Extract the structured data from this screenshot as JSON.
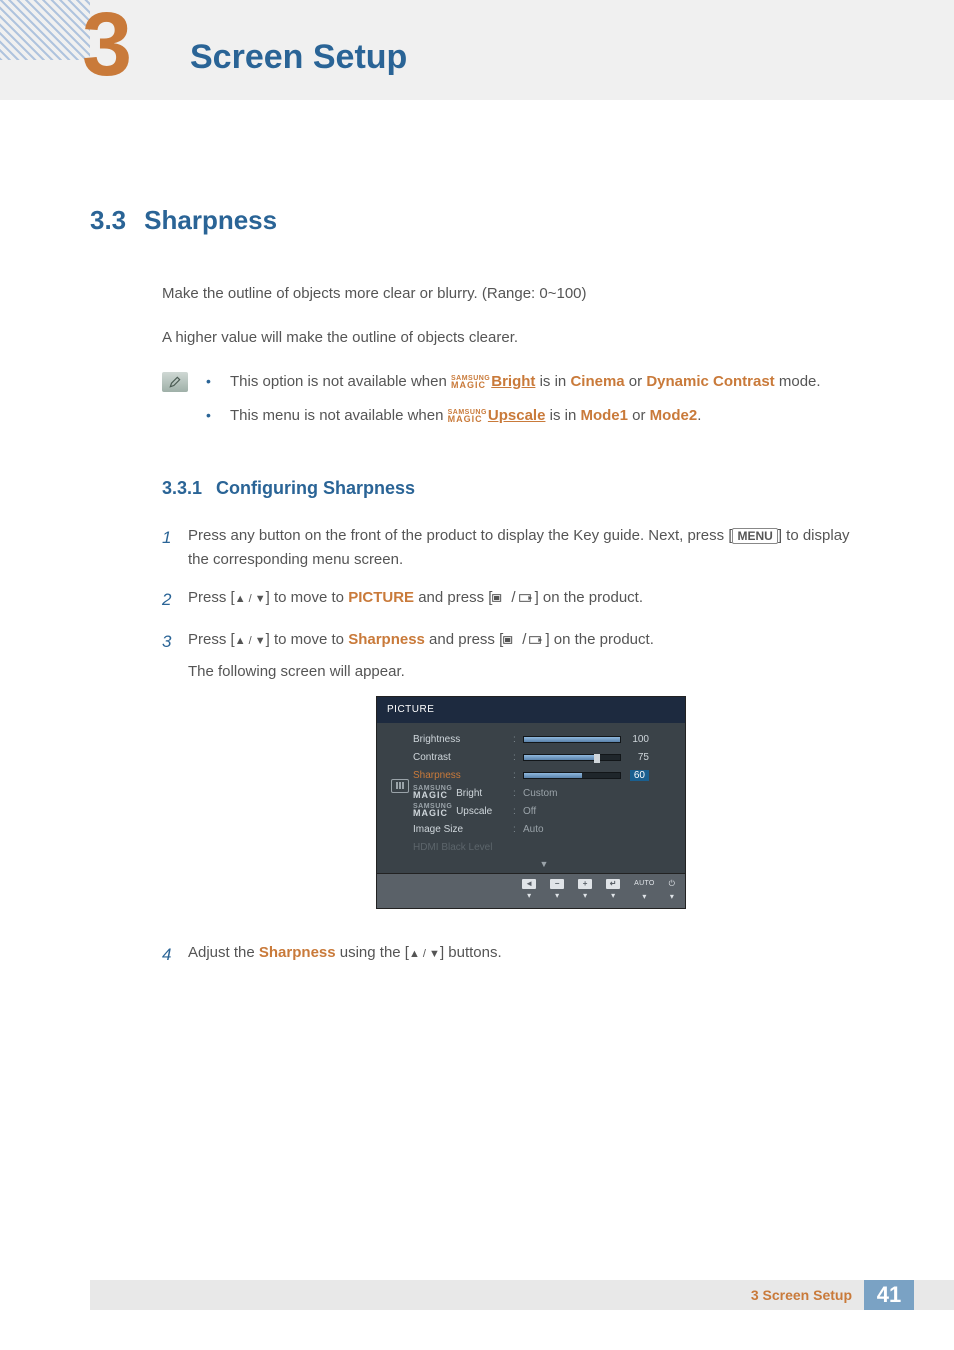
{
  "chapter": {
    "number": "3",
    "title": "Screen Setup"
  },
  "section": {
    "number": "3.3",
    "title": "Sharpness",
    "intro1": "Make the outline of objects more clear or blurry. (Range: 0~100)",
    "intro2": "A higher value will make the outline of objects clearer.",
    "notes": {
      "b1_pre": "This option is not available when ",
      "b1_link": "Bright",
      "b1_mid": " is in ",
      "b1_m1": "Cinema",
      "b1_or": " or ",
      "b1_m2": "Dynamic Contrast",
      "b1_post": " mode.",
      "b2_pre": "This menu is not available when ",
      "b2_link": "Upscale",
      "b2_mid": " is in ",
      "b2_m1": "Mode1",
      "b2_or": " or ",
      "b2_m2": "Mode2",
      "b2_post": "."
    }
  },
  "subsection": {
    "number": "3.3.1",
    "title": "Configuring Sharpness",
    "steps": {
      "s1a": "Press any button on the front of the product to display the Key guide. Next, press [",
      "s1b": "] to display the corresponding menu screen.",
      "menu": "MENU",
      "s2a": "Press [",
      "s2b": "] to move to ",
      "s2c": " and press [",
      "s2d": "] on the product.",
      "picture": "PICTURE",
      "s3a": "Press [",
      "s3b": "] to move to ",
      "s3c": " and press [",
      "s3d": "] on the product.",
      "sharpness": "Sharpness",
      "s3e": "The following screen will appear.",
      "s4a": "Adjust the ",
      "s4b": " using the [",
      "s4c": "] buttons."
    }
  },
  "magic": {
    "top": "SAMSUNG",
    "bot": "MAGIC"
  },
  "osd": {
    "title": "PICTURE",
    "rows": {
      "brightness": {
        "label": "Brightness",
        "value": 100,
        "pct": 100
      },
      "contrast": {
        "label": "Contrast",
        "value": 75,
        "pct": 75
      },
      "sharpness": {
        "label": "Sharpness",
        "value": 60,
        "pct": 60
      },
      "bright": {
        "label": "Bright",
        "value": "Custom"
      },
      "upscale": {
        "label": "Upscale",
        "value": "Off"
      },
      "imgsize": {
        "label": "Image Size",
        "value": "Auto"
      },
      "hdmibl": {
        "label": "HDMI Black Level"
      }
    },
    "footer": {
      "auto": "AUTO"
    }
  },
  "footer": {
    "text": "3 Screen Setup",
    "page": "41"
  },
  "chart_data": {
    "type": "table",
    "title": "PICTURE OSD menu",
    "rows": [
      {
        "item": "Brightness",
        "value": 100,
        "range": [
          0,
          100
        ]
      },
      {
        "item": "Contrast",
        "value": 75,
        "range": [
          0,
          100
        ]
      },
      {
        "item": "Sharpness",
        "value": 60,
        "range": [
          0,
          100
        ]
      },
      {
        "item": "SAMSUNG MAGIC Bright",
        "value": "Custom"
      },
      {
        "item": "SAMSUNG MAGIC Upscale",
        "value": "Off"
      },
      {
        "item": "Image Size",
        "value": "Auto"
      },
      {
        "item": "HDMI Black Level",
        "value": null
      }
    ]
  }
}
